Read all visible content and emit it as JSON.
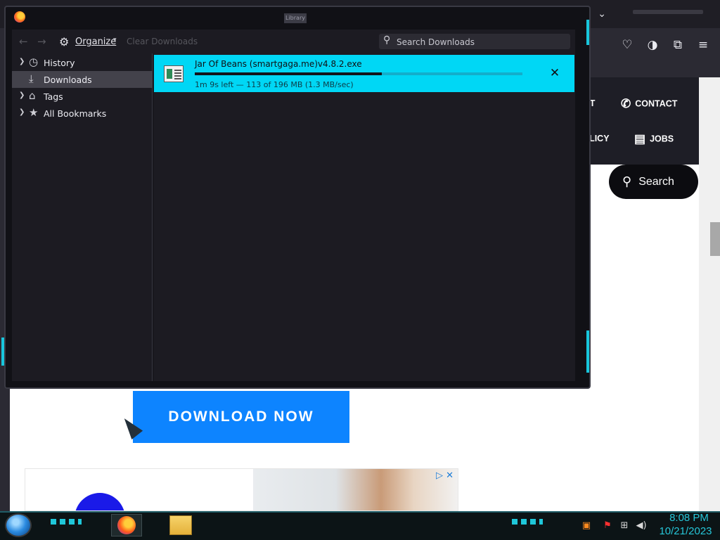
{
  "browser": {
    "tabs_menu_icon": "chevron-down-icon",
    "toolbar_icons": [
      "pocket-icon",
      "theme-icon",
      "extensions-icon",
      "hamburger-menu-icon"
    ]
  },
  "website": {
    "nav": {
      "about_partial": "OUT",
      "contact": "CONTACT",
      "policy_partial": "POLICY",
      "jobs": "JOBS"
    },
    "search_button": "Search",
    "download_button": "DOWNLOAD NOW",
    "ad_controls": "▷ ✕"
  },
  "library": {
    "window_title": "Library",
    "toolbar": {
      "organize_label": "Organize",
      "clear_downloads_label": "Clear Downloads",
      "search_placeholder": "Search Downloads"
    },
    "sidebar": {
      "items": [
        {
          "label": "History",
          "icon": "clock-icon",
          "expandable": true,
          "selected": false
        },
        {
          "label": "Downloads",
          "icon": "download-icon",
          "expandable": false,
          "selected": true
        },
        {
          "label": "Tags",
          "icon": "tag-icon",
          "expandable": true,
          "selected": false
        },
        {
          "label": "All Bookmarks",
          "icon": "star-icon",
          "expandable": true,
          "selected": false
        }
      ]
    },
    "downloads": [
      {
        "filename": "Jar Of Beans (smartgaga.me)v4.8.2.exe",
        "status": "1m 9s left — 113 of 196 MB (1.3 MB/sec)",
        "progress": 0.57
      }
    ]
  },
  "taskbar": {
    "time": "8:08 PM",
    "date": "10/21/2023"
  },
  "colors": {
    "download_highlight": "#00d7f5",
    "accent_teal": "#18c6dc",
    "download_now_blue": "#0d84ff"
  }
}
